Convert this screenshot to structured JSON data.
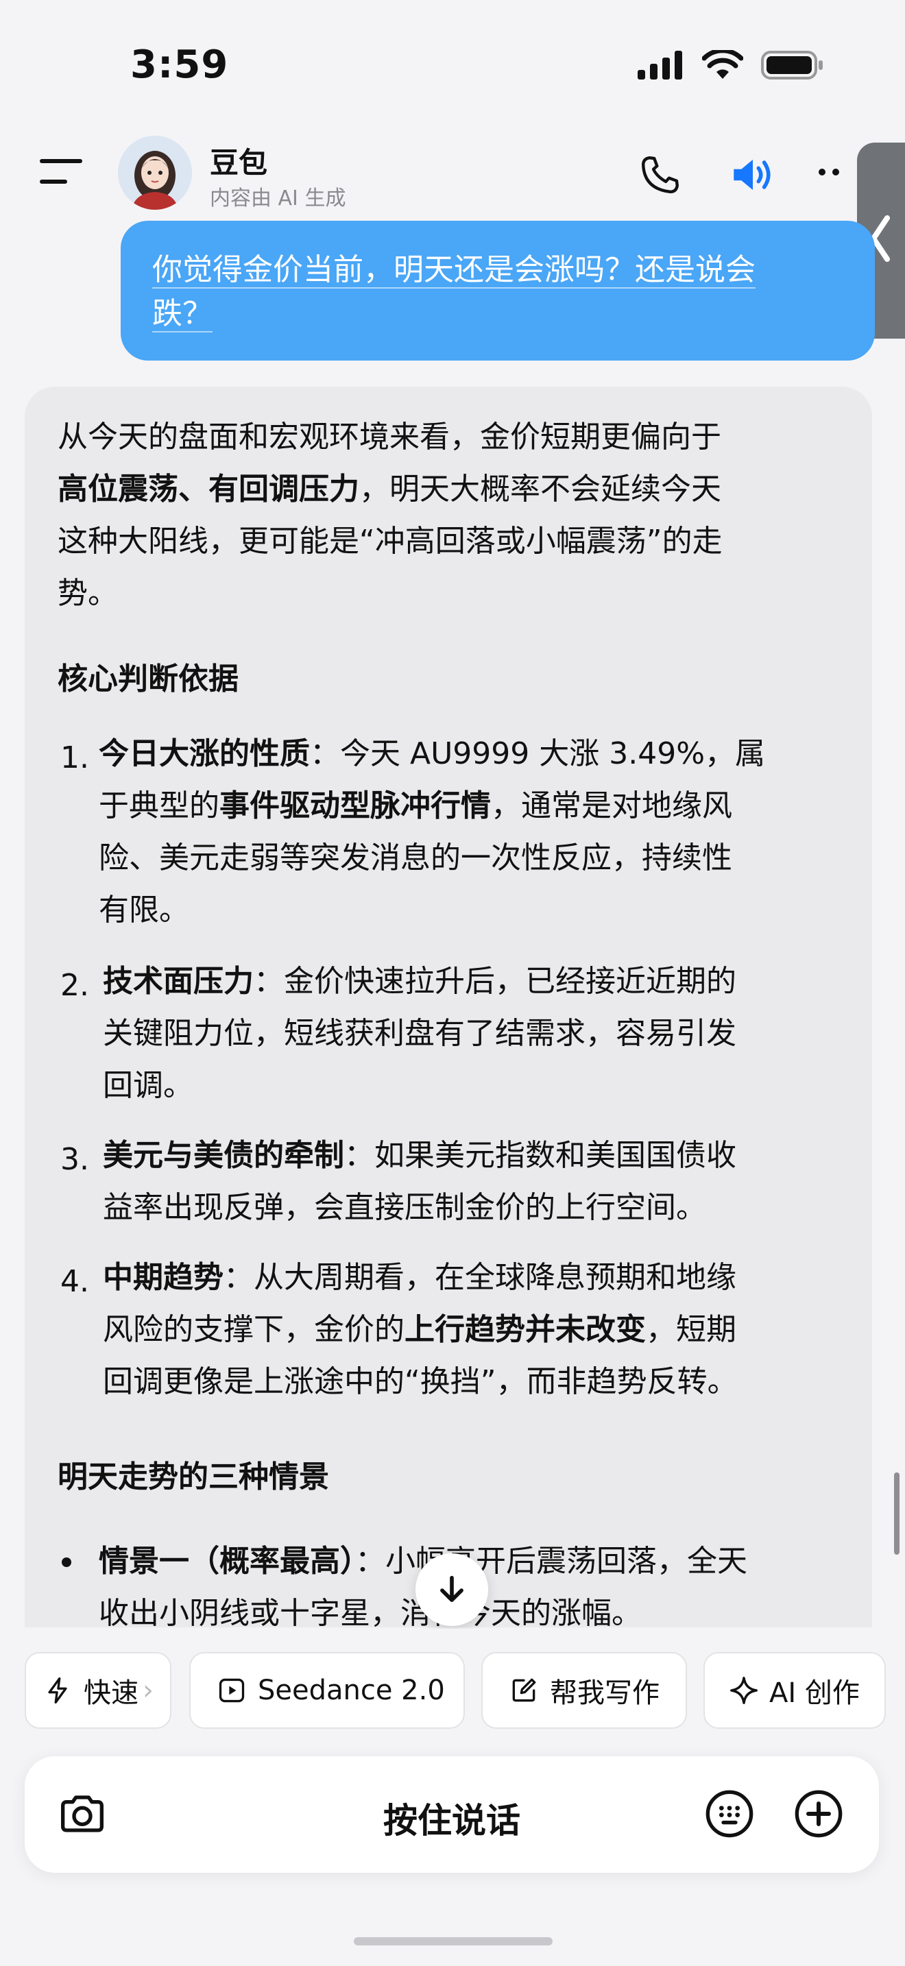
{
  "status_bar": {
    "time": "3:59"
  },
  "header": {
    "name": "豆包",
    "subtitle": "内容由 AI 生成"
  },
  "user_message": {
    "line1": "你觉得金价当前，明天还是会涨吗？还是说会",
    "line2": "跌？"
  },
  "answer": {
    "intro": {
      "l1": "从今天的盘面和宏观环境来看，金价短期更偏向于",
      "l2_bold": "高位震荡、有回调压力",
      "l2_rest": "，明天大概率不会延续今天",
      "l3": "这种大阳线，更可能是“冲高回落或小幅震荡”的走",
      "l4": "势。"
    },
    "section1_title": "核心判断依据",
    "items": [
      {
        "num": "1.",
        "a_bold": "今日大涨的性质",
        "a_rest": "：今天 AU9999 大涨 3.49%，属",
        "b_pre": "于典型的",
        "b_bold": "事件驱动型脉冲行情",
        "b_rest": "，通常是对地缘风",
        "c": "险、美元走弱等突发消息的一次性反应，持续性",
        "d": "有限。"
      },
      {
        "num": "2.",
        "a_bold": "技术面压力",
        "a_rest": "：金价快速拉升后，已经接近近期的",
        "b": "关键阻力位，短线获利盘有了结需求，容易引发",
        "c": "回调。"
      },
      {
        "num": "3.",
        "a_bold": "美元与美债的牵制",
        "a_rest": "：如果美元指数和美国国债收",
        "b": "益率出现反弹，会直接压制金价的上行空间。"
      },
      {
        "num": "4.",
        "a_bold": "中期趋势",
        "a_rest": "：从大周期看，在全球降息预期和地缘",
        "b_pre": "风险的支撑下，金价的",
        "b_bold": "上行趋势并未改变",
        "b_rest": "，短期",
        "c": "回调更像是上涨途中的“换挡”，而非趋势反转。"
      }
    ],
    "section2_title": "明天走势的三种情景",
    "scenario": {
      "bold": "情景一（概率最高）",
      "a_rest": "：小幅高开后震荡回落，全天",
      "b": "收出小阴线或十字星，消化今天的涨幅。"
    }
  },
  "chips": [
    "快速",
    "Seedance 2.0",
    "帮我写作",
    "AI 创作"
  ],
  "input": {
    "label": "按住说话"
  },
  "colors": {
    "accent": "#1677ff",
    "bubble": "#4aa6f6"
  },
  "icons": [
    "signal-icon",
    "wifi-icon",
    "battery-icon",
    "menu-icon",
    "phone-icon",
    "speaker-icon",
    "more-icon",
    "chevron-left-icon",
    "arrow-down-icon",
    "bolt-icon",
    "play-icon",
    "edit-icon",
    "sparkle-icon",
    "camera-icon",
    "keyboard-icon",
    "plus-icon"
  ]
}
